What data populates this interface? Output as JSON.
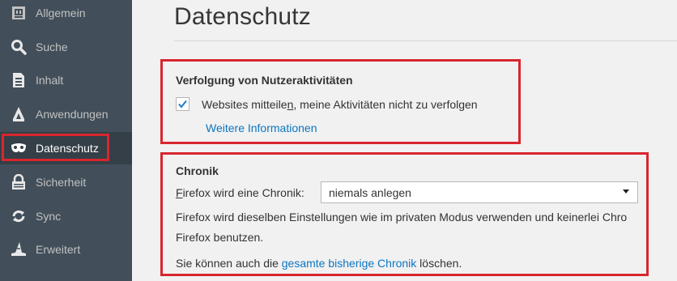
{
  "sidebar": {
    "items": [
      {
        "label": "Allgemein",
        "icon": "general-icon",
        "selected": false
      },
      {
        "label": "Suche",
        "icon": "search-icon",
        "selected": false
      },
      {
        "label": "Inhalt",
        "icon": "document-icon",
        "selected": false
      },
      {
        "label": "Anwendungen",
        "icon": "applications-icon",
        "selected": false
      },
      {
        "label": "Datenschutz",
        "icon": "privacy-mask-icon",
        "selected": true
      },
      {
        "label": "Sicherheit",
        "icon": "lock-icon",
        "selected": false
      },
      {
        "label": "Sync",
        "icon": "sync-icon",
        "selected": false
      },
      {
        "label": "Erweitert",
        "icon": "wizard-hat-icon",
        "selected": false
      }
    ]
  },
  "main": {
    "title": "Datenschutz",
    "tracking": {
      "heading": "Verfolgung von Nutzeraktivitäten",
      "checkbox_label_pre": "Websites mitteile",
      "checkbox_label_accel": "n",
      "checkbox_label_post": ", meine Aktivitäten nicht zu verfolgen",
      "checked": true,
      "more_info": "Weitere Informationen"
    },
    "history": {
      "heading": "Chronik",
      "select_label_accel": "F",
      "select_label_rest": "irefox wird eine Chronik:",
      "select_value": "niemals anlegen",
      "desc_line1": "Firefox wird dieselben Einstellungen wie im privaten Modus verwenden und keinerlei Chro",
      "desc_line2": "Firefox benutzen.",
      "clear_pre": "Sie können auch die ",
      "clear_link": "gesamte bisherige Chronik",
      "clear_post": " löschen."
    }
  },
  "colors": {
    "sidebar_bg": "#424f5a",
    "sidebar_selected_bg": "#343f48",
    "link": "#0c76c2",
    "highlight_box": "#d9262e"
  }
}
